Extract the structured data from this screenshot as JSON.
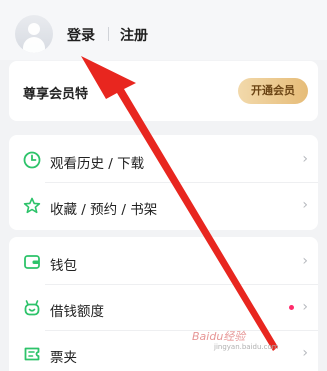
{
  "header": {
    "login_label": "登录",
    "register_label": "注册"
  },
  "vip": {
    "title": "尊享会员特",
    "button_label": "开通会员"
  },
  "menu_group_1": [
    {
      "label": "观看历史 / 下载",
      "icon": "clock-icon"
    },
    {
      "label": "收藏 / 预约 / 书架",
      "icon": "star-icon"
    }
  ],
  "menu_group_2": [
    {
      "label": "钱包",
      "icon": "wallet-icon"
    },
    {
      "label": "借钱额度",
      "icon": "loan-icon",
      "badge": "red-dot"
    },
    {
      "label": "票夹",
      "icon": "ticket-icon"
    }
  ],
  "colors": {
    "accent_green": "#2dc36a",
    "vip_gold": "#e6bc78",
    "annotation_red": "#e8261f",
    "badge_red": "#ff2b6b"
  },
  "watermark": {
    "text": "Baidu经验",
    "url": "jingyan.baidu.com"
  }
}
